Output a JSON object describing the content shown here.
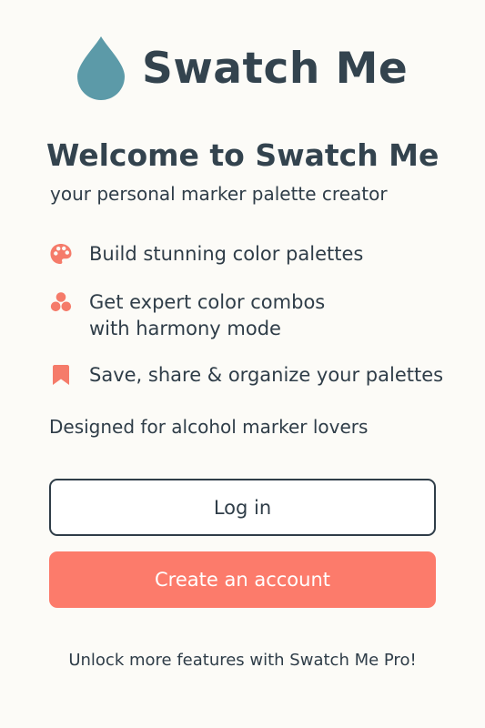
{
  "header": {
    "app_name": "Swatch Me",
    "logo_icon": "drop-icon"
  },
  "welcome": {
    "title": "Welcome to Swatch Me",
    "subtitle": "your personal marker palette creator"
  },
  "features": [
    {
      "icon": "palette-icon",
      "text": "Build stunning color palettes"
    },
    {
      "icon": "color-harmony-icon",
      "text": "Get expert color combos\nwith harmony mode"
    },
    {
      "icon": "bookmark-icon",
      "text": "Save, share & organize your palettes"
    }
  ],
  "tagline": "Designed for alcohol marker lovers",
  "actions": {
    "login_label": "Log in",
    "create_account_label": "Create an account"
  },
  "footer": {
    "pro_text": "Unlock more features with Swatch Me Pro!"
  },
  "colors": {
    "background": "#fcfbf7",
    "brand_teal": "#5c9aa8",
    "accent_coral": "#fc7b6b",
    "text_dark": "#2f3d48"
  }
}
